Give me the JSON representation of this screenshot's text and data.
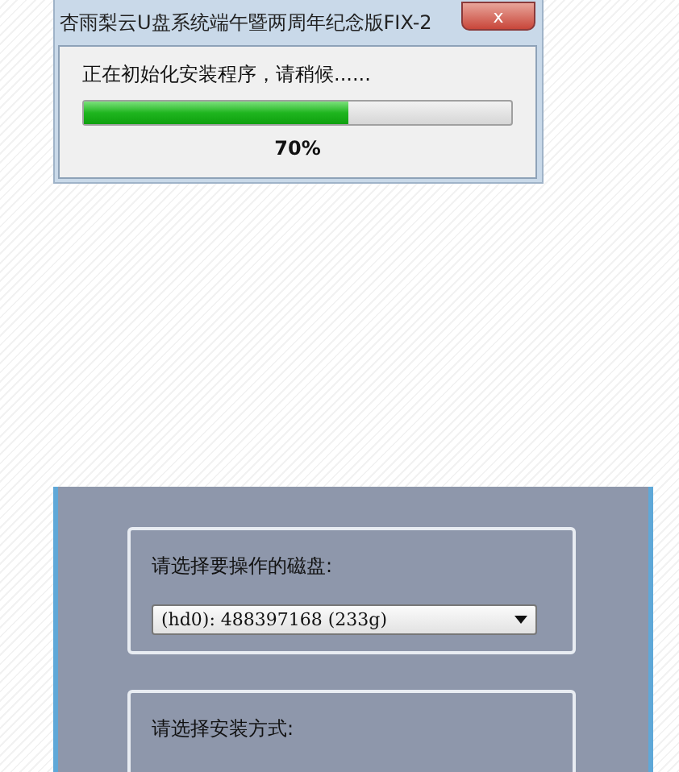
{
  "progress_dialog": {
    "title": "杏雨梨云U盘系统端午暨两周年纪念版FIX-2",
    "close_label": "x",
    "message": "正在初始化安装程序，请稍候......",
    "level": 0.62,
    "percent": "70%"
  },
  "installer": {
    "disk_group": {
      "label": "请选择要操作的磁盘:",
      "disk_select": {
        "value": "(hd0): 488397168 (233g)"
      }
    },
    "method_group": {
      "label": "请选择安装方式:"
    }
  }
}
